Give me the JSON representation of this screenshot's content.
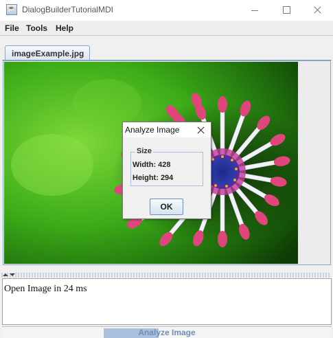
{
  "window": {
    "title": "DialogBuilderTutorialMDI",
    "icon": "java-icon"
  },
  "menu": {
    "items": [
      "File",
      "Tools",
      "Help"
    ]
  },
  "tabs": [
    {
      "label": "imageExample.jpg",
      "active": true
    }
  ],
  "image": {
    "description": "flower",
    "accent_colors": [
      "#3aa617",
      "#e0457c",
      "#2a2f9a"
    ]
  },
  "log": {
    "text": "Open Image in 24 ms"
  },
  "bottom": {
    "button_label": "Analyze Image",
    "progress_color": "#a9c0de"
  },
  "dialog": {
    "title": "Analyze Image",
    "group_label": "Size",
    "width_text": "Width: 428",
    "height_text": "Height: 294",
    "ok_label": "OK"
  }
}
